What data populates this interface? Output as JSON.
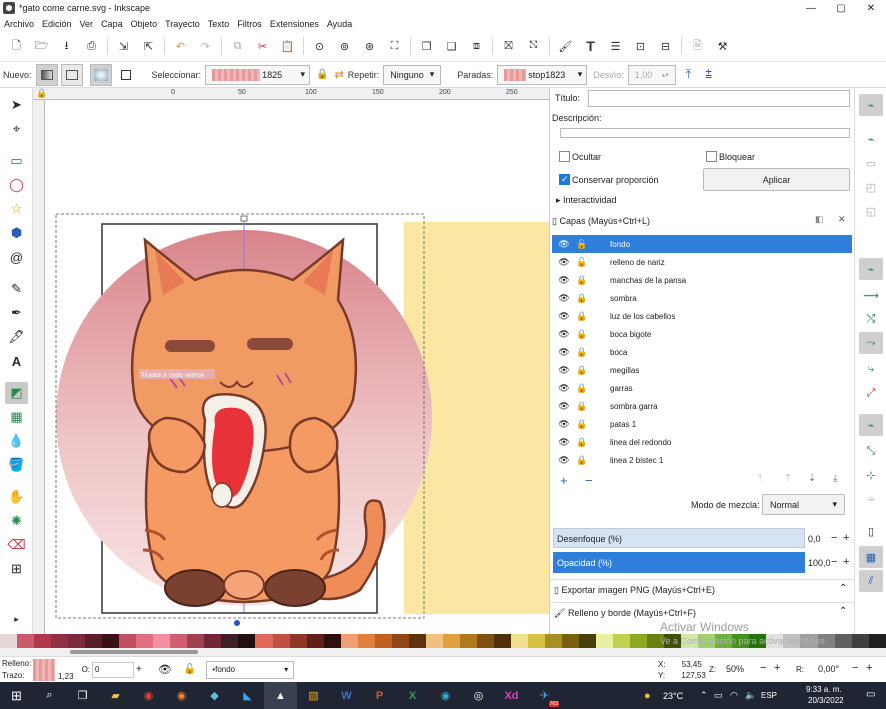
{
  "window": {
    "title": "*gato come carne.svg - Inkscape",
    "buttons": [
      "—",
      "▢",
      "✕"
    ]
  },
  "menu": [
    "Archivo",
    "Edición",
    "Ver",
    "Capa",
    "Objeto",
    "Trayecto",
    "Texto",
    "Filtros",
    "Extensiones",
    "Ayuda"
  ],
  "toolctl": {
    "nuevo_label": "Nuevo:",
    "seleccionar_label": "Seleccionar:",
    "seleccionar_value": "1825",
    "repetir_label": "Repetir:",
    "repetir_value": "Ninguno",
    "paradas_label": "Paradas:",
    "paradas_value": "stop1823",
    "desvio_label": "Desvío:",
    "desvio_value": "1,00"
  },
  "ruler": {
    "ticks": [
      "0",
      "50",
      "100",
      "150",
      "200",
      "250",
      "300",
      "350"
    ]
  },
  "canvas": {
    "tooltip": "Tirador a nodo vértice"
  },
  "panel": {
    "titulo_label": "Título:",
    "descripcion_label": "Descripción:",
    "ocultar_label": "Ocultar",
    "bloquear_label": "Bloquear",
    "conservar_label": "Conservar proporción",
    "aplicar_label": "Aplicar",
    "interactividad_label": "Interactividad",
    "capas_title": "Capas (Mayús+Ctrl+L)",
    "layers": [
      "fondo",
      "relleno de nariz",
      "manchas de la pansa",
      "sombra",
      "luz de los cabellos",
      "boca bigote",
      "boca",
      "megillas",
      "garras",
      "sombra garra",
      "patas 1",
      "linea del redondo",
      "linea 2 bistec 1"
    ],
    "modo_label": "Modo de mezcla:",
    "modo_value": "Normal",
    "desenfoque_label": "Desenfoque (%)",
    "desenfoque_value": "0,0",
    "opacidad_label": "Opacidad (%)",
    "opacidad_value": "100,0",
    "exportar_label": "Exportar imagen PNG (Mayús+Ctrl+E)",
    "relleno_label": "Relleno y borde (Mayús+Ctrl+F)"
  },
  "status": {
    "relleno_label": "Relleno:",
    "trazo_label": "Trazo:",
    "trazo_value": "1,23",
    "opacity_label": "O:",
    "opacity_value": "0",
    "layer_value": "•fondo",
    "x_label": "X:",
    "x_value": "53,45",
    "y_label": "Y:",
    "y_value": "127,53",
    "zoom_label": "Z:",
    "zoom_value": "50%",
    "rot_label": "R:",
    "rot_value": "0,00°"
  },
  "watermark": {
    "line1": "Activar Windows",
    "line2": "Ve a Configuración para activar Windows."
  },
  "taskbar": {
    "weather": "23°C",
    "lang": "ESP",
    "time": "9:33 a. m.",
    "date": "20/3/2022",
    "badge": "763"
  },
  "palette_colors": [
    "#e6d6d8",
    "#c85c6a",
    "#b03848",
    "#903040",
    "#7a2a38",
    "#5a1e28",
    "#3a1018",
    "#c25060",
    "#e07080",
    "#f090a0",
    "#d06070",
    "#a04050",
    "#702838",
    "#402028",
    "#201010",
    "#e06858",
    "#c05040",
    "#903828",
    "#602018",
    "#301008",
    "#f0a070",
    "#e08040",
    "#c06020",
    "#904818",
    "#603010",
    "#f0c080",
    "#e0a040",
    "#b07820",
    "#805010",
    "#503008",
    "#f0e090",
    "#d8c040",
    "#a89020",
    "#786010",
    "#484008",
    "#e8f0a0",
    "#c0d050",
    "#90a820",
    "#688010",
    "#405008",
    "#d0e8b0",
    "#a0d070",
    "#70b040",
    "#489020",
    "#287010",
    "#e0e0e0",
    "#c0c0c0",
    "#a0a0a0",
    "#808080",
    "#606060",
    "#404040",
    "#202020"
  ]
}
